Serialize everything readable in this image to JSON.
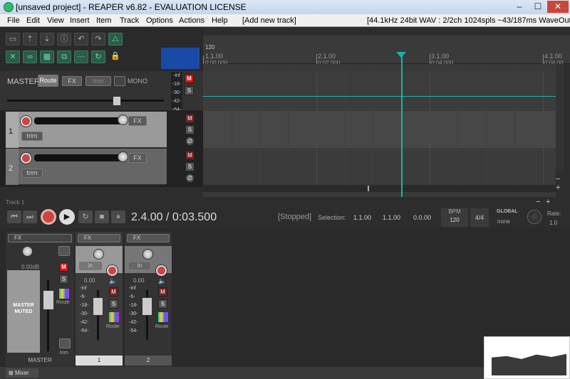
{
  "window": {
    "title": "[unsaved project] - REAPER v6.82 - EVALUATION LICENSE",
    "min": "–",
    "max": "☐",
    "close": "✕"
  },
  "menu": {
    "file": "File",
    "edit": "Edit",
    "view": "View",
    "insert": "Insert",
    "item": "Item",
    "track": "Track",
    "options": "Options",
    "actions": "Actions",
    "help": "Help",
    "add_track": "[Add new track]",
    "audio_info": "[44.1kHz 24bit WAV : 2/2ch 1024spls ~43/187ms WaveOut]"
  },
  "master": {
    "label": "MASTER",
    "route": "Route",
    "fx": "FX",
    "trim": "trim",
    "mono": "MONO",
    "meter": "-inf\n-18-\n-30-\n-42-\n-54-",
    "m": "M",
    "s": "S"
  },
  "tracks": [
    {
      "num": "1",
      "fx": "FX",
      "trim": "trim",
      "m": "M",
      "s": "S",
      "phase": "∅"
    },
    {
      "num": "2",
      "fx": "FX",
      "trim": "trim",
      "m": "M",
      "s": "S",
      "phase": "∅"
    }
  ],
  "ruler": {
    "tempo": "120",
    "m1": "1.1.00",
    "t1": "0:00.000",
    "m2": "2.1.00",
    "t2": "0:02.000",
    "m3": "3.1.00",
    "t3": "0:04.000",
    "m4": "4.1.00",
    "t4": "0:06.00"
  },
  "statusline": "Track 1",
  "transport": {
    "position": "2.4.00 / 0:03.500",
    "state": "[Stopped]",
    "selection_label": "Selection:",
    "sel_start": "1.1.00",
    "sel_end": "1.1.00",
    "sel_len": "0.0.00",
    "bpm_label": "BPM",
    "bpm": "120",
    "timesig": "4/4",
    "global": "GLOBAL",
    "none": "none",
    "rate_label": "Rate:",
    "rate": "1.0"
  },
  "mixer": {
    "master_fx": "FX",
    "master_vol": "0.00dB",
    "master_muted": "MASTER\nMUTED",
    "route": "Route",
    "trim": "trim",
    "master_name": "MASTER",
    "m": "M",
    "s": "S",
    "ch1_fx": "FX",
    "ch1_in": "in",
    "ch1_vol": "0.00",
    "ch1_name": "1",
    "ch2_fx": "FX",
    "ch2_in": "in",
    "ch2_vol": "0.00",
    "ch2_name": "2",
    "meter": "-inf\n-6-\n-18-\n-30-\n-42-\n-54-",
    "tab": "Mixer"
  }
}
